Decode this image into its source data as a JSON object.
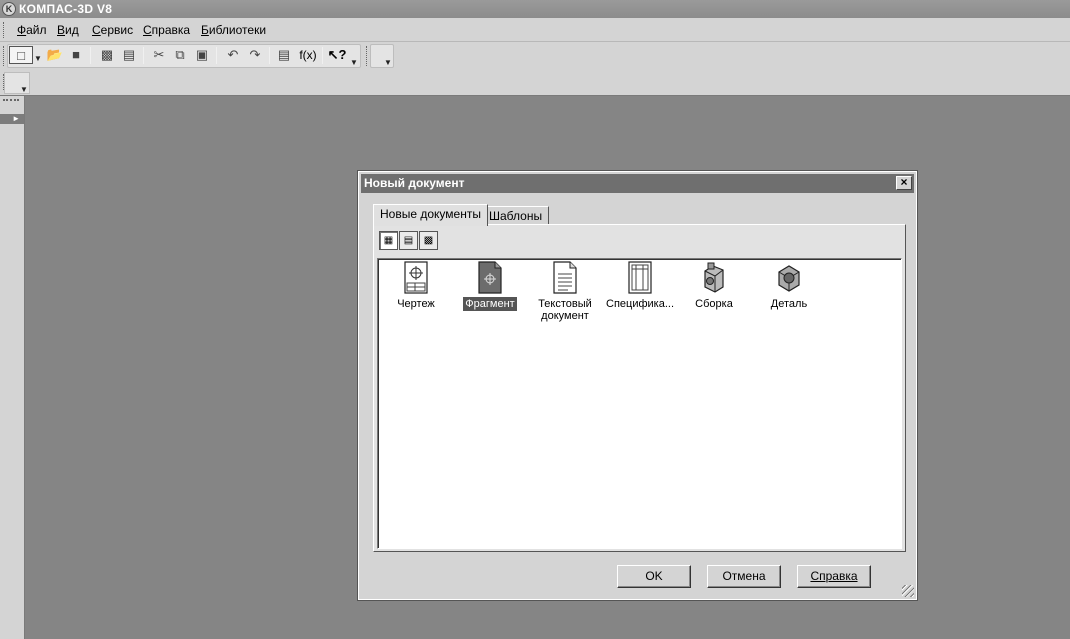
{
  "app": {
    "title": "КОМПАС-3D V8"
  },
  "menu": [
    {
      "label": "Файл",
      "mnemonic": "Ф"
    },
    {
      "label": "Вид",
      "mnemonic": "В"
    },
    {
      "label": "Сервис",
      "mnemonic": "С"
    },
    {
      "label": "Справка",
      "mnemonic": "С"
    },
    {
      "label": "Библиотеки",
      "mnemonic": "Б"
    }
  ],
  "toolbar": {
    "icons": [
      "new-document-icon",
      "open-icon",
      "save-icon",
      "print-icon",
      "print-preview-icon",
      "cut-icon",
      "copy-icon",
      "paste-icon",
      "undo-icon",
      "redo-icon",
      "properties-icon",
      "function-icon",
      "context-help-icon"
    ],
    "function_label": "f(x)",
    "help_label": "?"
  },
  "dialog": {
    "title": "Новый документ",
    "tabs": [
      "Новые документы",
      "Шаблоны"
    ],
    "selected_tab": "Новые документы",
    "view_modes": [
      "large-icons",
      "list",
      "details"
    ],
    "items": [
      {
        "label": "Чертеж",
        "icon": "drawing-icon",
        "selected": false
      },
      {
        "label": "Фрагмент",
        "icon": "fragment-icon",
        "selected": true
      },
      {
        "label": "Текстовый документ",
        "icon": "text-document-icon",
        "selected": false
      },
      {
        "label": "Специфика...",
        "icon": "specification-icon",
        "selected": false
      },
      {
        "label": "Сборка",
        "icon": "assembly-icon",
        "selected": false
      },
      {
        "label": "Деталь",
        "icon": "part-icon",
        "selected": false
      }
    ],
    "buttons": {
      "ok": "OK",
      "cancel": "Отмена",
      "help": "Справка"
    }
  }
}
